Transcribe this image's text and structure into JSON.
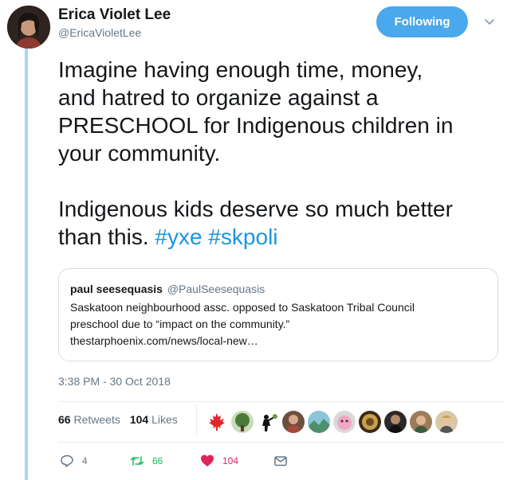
{
  "author": {
    "name": "Erica Violet Lee",
    "handle": "@EricaVioletLee",
    "follow_label": "Following"
  },
  "tweet": {
    "paragraphs": [
      "Imagine having enough time, money,\nand hatred to organize against a\nPRESCHOOL for Indigenous children in\nyour community.",
      "Indigenous kids deserve so much better\nthan this."
    ],
    "hashtags": [
      "#yxe",
      "#skpoli"
    ]
  },
  "quote": {
    "name": "paul seesequasis",
    "handle": "@PaulSeesequasis",
    "text": "Saskatoon neighbourhood assc. opposed to Saskatoon Tribal Council\npreschool due to “impact on the community.”\nthestarphoenix.com/news/local-new…"
  },
  "timestamp": "3:38 PM - 30 Oct 2018",
  "stats": {
    "retweets_count": "66",
    "retweets_label": "Retweets",
    "likes_count": "104",
    "likes_label": "Likes"
  },
  "likers": [
    "maple-leaf-icon",
    "tree-avatar",
    "flower-thrower-avatar",
    "person-avatar-1",
    "landscape-avatar",
    "pink-creature-avatar",
    "gold-emblem-avatar",
    "person-avatar-2",
    "person-avatar-3",
    "person-avatar-4"
  ],
  "actions": {
    "reply_count": "4",
    "retweet_count": "66",
    "like_count": "104"
  },
  "colors": {
    "accent": "#1b95e0",
    "follow_button": "#4aa8ec",
    "retweet": "#17bf63",
    "like": "#e0245e",
    "muted": "#657786",
    "thread_line": "#a6d7f1"
  }
}
